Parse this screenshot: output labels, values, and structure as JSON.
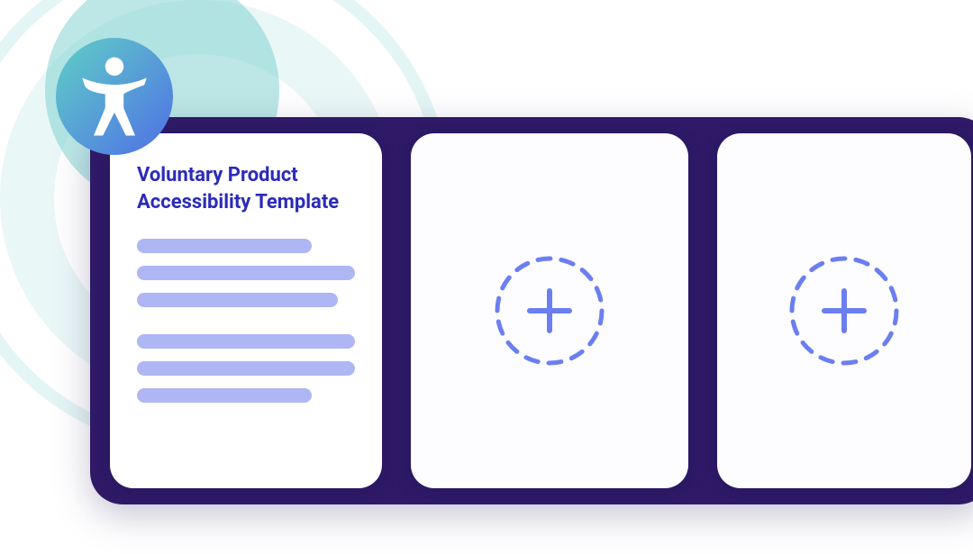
{
  "badge": {
    "icon_name": "accessibility-icon"
  },
  "panels": {
    "main": {
      "title": "Voluntary Product Accessibility Template"
    },
    "add1": {
      "icon_name": "add-icon"
    },
    "add2": {
      "icon_name": "add-icon"
    }
  },
  "colors": {
    "panel_bg": "#2e1a67",
    "title": "#2b2bb8",
    "line": "#aeb6f3",
    "add_stroke": "#6b7ff0",
    "badge_start": "#5fd0c6",
    "badge_end": "#4f6fe6"
  }
}
